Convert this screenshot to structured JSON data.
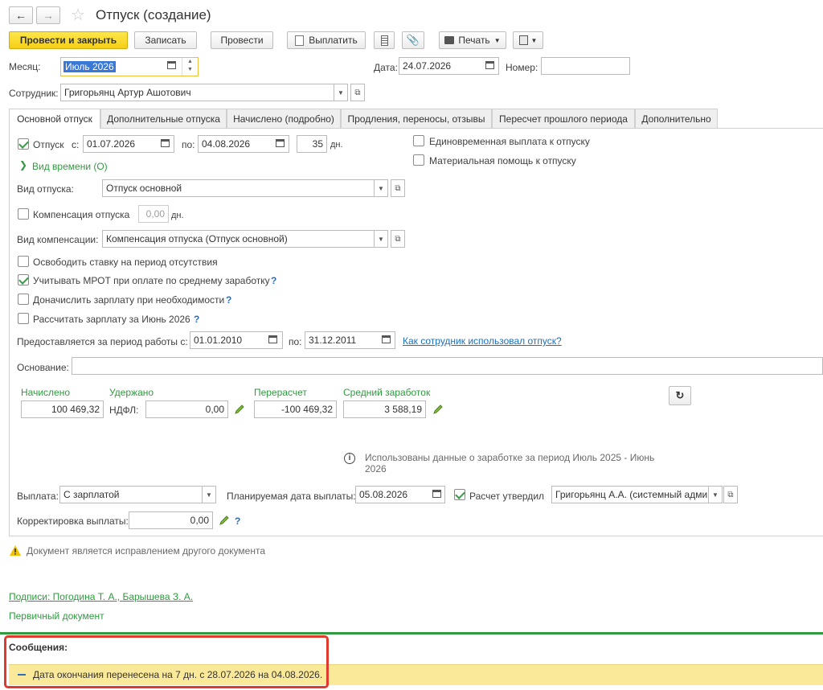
{
  "window": {
    "title": "Отпуск (создание)"
  },
  "toolbar": {
    "post_close": "Провести и закрыть",
    "save": "Записать",
    "post": "Провести",
    "pay": "Выплатить",
    "print": "Печать"
  },
  "header": {
    "month_label": "Месяц:",
    "month_value": "Июль 2026",
    "date_label": "Дата:",
    "date_value": "24.07.2026",
    "number_label": "Номер:",
    "number_value": "",
    "employee_label": "Сотрудник:",
    "employee_value": "Григорьянц Артур Ашотович"
  },
  "tabs": [
    {
      "label": "Основной отпуск"
    },
    {
      "label": "Дополнительные отпуска"
    },
    {
      "label": "Начислено (подробно)"
    },
    {
      "label": "Продления, переносы, отзывы"
    },
    {
      "label": "Пересчет прошлого периода"
    },
    {
      "label": "Дополнительно"
    }
  ],
  "main": {
    "vacation_label": "Отпуск",
    "from_label": "с:",
    "from_value": "01.07.2026",
    "to_label": "по:",
    "to_value": "04.08.2026",
    "days_value": "35",
    "days_unit": "дн.",
    "lump_sum": "Единовременная выплата к отпуску",
    "material_help": "Материальная помощь к отпуску",
    "time_kind": "Вид времени (О)",
    "vacation_kind_label": "Вид отпуска:",
    "vacation_kind_value": "Отпуск основной",
    "compensation_label": "Компенсация отпуска",
    "compensation_value": "0,00",
    "compensation_unit": "дн.",
    "comp_kind_label": "Вид компенсации:",
    "comp_kind_value": "Компенсация отпуска (Отпуск основной)",
    "release_rate": "Освободить ставку на период отсутствия",
    "consider_mrot": "Учитывать МРОТ при оплате по среднему заработку",
    "add_salary": "Доначислить зарплату при необходимости",
    "calc_salary": "Рассчитать зарплату за Июнь 2026",
    "work_period_label": "Предоставляется за период работы с:",
    "work_from": "01.01.2010",
    "work_to_label": "по:",
    "work_to": "31.12.2011",
    "how_used_link": "Как сотрудник использовал отпуск?",
    "basis_label": "Основание:",
    "basis_value": "",
    "accrued_label": "Начислено",
    "withheld_label": "Удержано",
    "recalc_label": "Перерасчет",
    "avg_label": "Средний заработок",
    "accrued_value": "100 469,32",
    "ndfl_label": "НДФЛ:",
    "ndfl_value": "0,00",
    "recalc_value": "-100 469,32",
    "avg_value": "3 588,19",
    "info_text_1": "Использованы данные о заработке за период Июль 2025 - Июнь",
    "info_text_2": "2026",
    "payout_label": "Выплата:",
    "payout_value": "С зарплатой",
    "planned_date_label": "Планируемая дата выплаты:",
    "planned_date_value": "05.08.2026",
    "approved_label": "Расчет утвердил",
    "approved_value": "Григорьянц А.А. (системный адми",
    "adjust_label": "Корректировка выплаты:",
    "adjust_value": "0,00",
    "help_mark": "?"
  },
  "footer": {
    "warning": "Документ является исправлением другого документа",
    "signatures": "Подписи: Погодина Т. А., Барышева З. А.",
    "primary_doc": "Первичный документ"
  },
  "messages": {
    "title": "Сообщения:",
    "item": "Дата окончания перенесена на 7 дн. с 28.07.2026 на 04.08.2026."
  },
  "colors": {
    "primary_button": "#f6cf15",
    "accent_green": "#2f9a3f",
    "link_blue": "#1d6fbf",
    "message_bg": "#fbe99a",
    "highlight_red": "#e03a2f"
  }
}
